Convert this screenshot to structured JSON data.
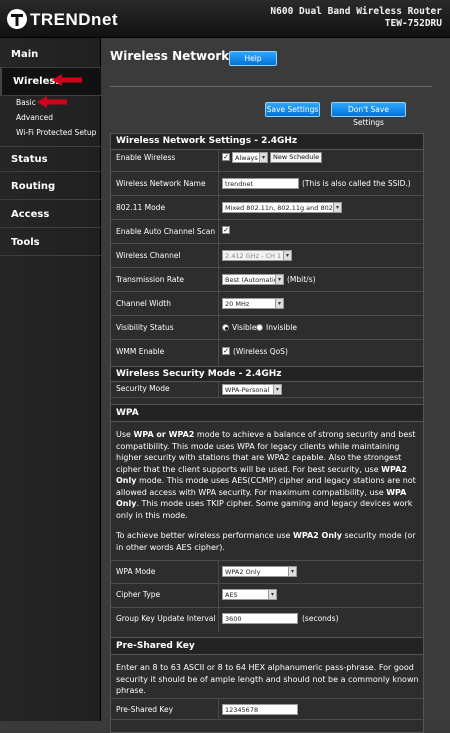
{
  "header": {
    "logo_text": "TRENDnet",
    "product_line1": "N600 Dual Band Wireless Router",
    "product_line2": "TEW-752DRU"
  },
  "sidebar": {
    "items": [
      {
        "label": "Main"
      },
      {
        "label": "Wireless"
      },
      {
        "label": "Status"
      },
      {
        "label": "Routing"
      },
      {
        "label": "Access"
      },
      {
        "label": "Tools"
      }
    ],
    "sub_items": [
      {
        "label": "Basic"
      },
      {
        "label": "Advanced"
      },
      {
        "label": "Wi-Fi Protected Setup"
      }
    ]
  },
  "page": {
    "title": "Wireless Network",
    "help_label": "Help",
    "save_label": "Save Settings",
    "dont_save_label": "Don't Save Settings"
  },
  "wireless_settings": {
    "heading": "Wireless Network Settings - 2.4GHz",
    "enable_wireless": {
      "label": "Enable Wireless",
      "checked": true,
      "schedule": "Always",
      "new_schedule_label": "New Schedule"
    },
    "network_name": {
      "label": "Wireless Network Name",
      "value": "trendnet",
      "note": "(This is also called the SSID.)"
    },
    "mode": {
      "label": "802.11 Mode",
      "value": "Mixed 802.11n, 802.11g and 802.11b"
    },
    "auto_channel": {
      "label": "Enable Auto Channel Scan",
      "checked": true
    },
    "channel": {
      "label": "Wireless Channel",
      "value": "2.412 GHz - CH 1"
    },
    "rate": {
      "label": "Transmission Rate",
      "value": "Best (Automatic)",
      "unit": "(Mbit/s)"
    },
    "width": {
      "label": "Channel Width",
      "value": "20 MHz"
    },
    "visibility": {
      "label": "Visibility Status",
      "option1": "Visible",
      "option2": "Invisible",
      "selected": "Visible"
    },
    "wmm": {
      "label": "WMM Enable",
      "checked": true,
      "note": "(Wireless QoS)"
    }
  },
  "security": {
    "heading": "Wireless Security Mode - 2.4GHz",
    "mode_label": "Security Mode",
    "mode_value": "WPA-Personal"
  },
  "wpa": {
    "heading": "WPA",
    "description": "Use WPA or WPA2 mode to achieve a balance of strong security and best compatibility. This mode uses WPA for legacy clients while maintaining higher security with stations that are WPA2 capable. Also the strongest cipher that the client supports will be used. For best security, use WPA2 Only mode. This mode uses AES(CCMP) cipher and legacy stations are not allowed access with WPA security. For maximum compatibility, use WPA Only. This mode uses TKIP cipher. Some gaming and legacy devices work only in this mode.",
    "tip": "To achieve better wireless performance use WPA2 Only security mode (or in other words AES cipher).",
    "mode": {
      "label": "WPA Mode",
      "value": "WPA2 Only"
    },
    "cipher": {
      "label": "Cipher Type",
      "value": "AES"
    },
    "group_key": {
      "label": "Group Key Update Interval",
      "value": "3600",
      "unit": "(seconds)"
    }
  },
  "psk": {
    "heading": "Pre-Shared Key",
    "description": "Enter an 8 to 63 ASCII or 8 to 64 HEX alphanumeric pass-phrase. For good security it should be of ample length and should not be a commonly known phrase.",
    "key_label": "Pre-Shared Key",
    "key_value": "12345678"
  },
  "colors": {
    "accent_blue": "#1a8fe8",
    "annotation_red": "#d0021b"
  }
}
